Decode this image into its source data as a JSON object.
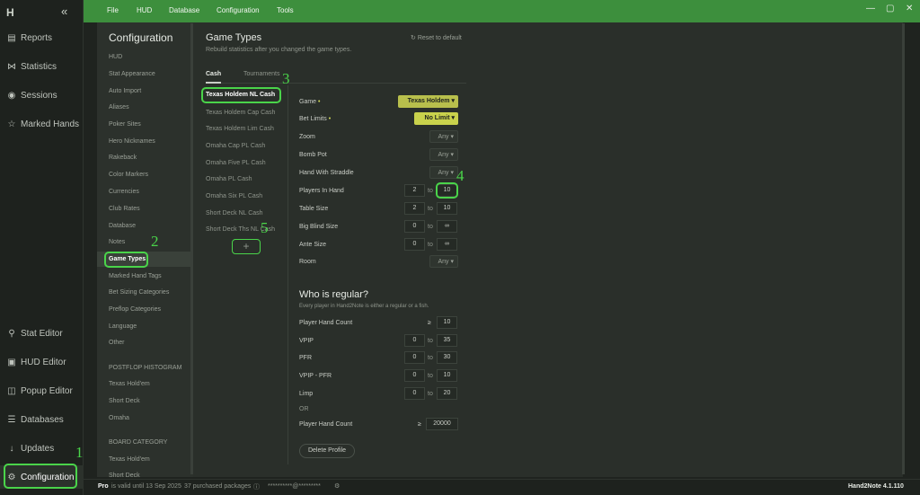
{
  "app": {
    "name": "Hand2Note",
    "version": "Hand2Note 4.1.110"
  },
  "nav": {
    "collapse": "«",
    "top_items": [
      {
        "label": "Reports",
        "icon": "report-icon"
      },
      {
        "label": "Statistics",
        "icon": "statistics-icon"
      },
      {
        "label": "Sessions",
        "icon": "sessions-icon"
      },
      {
        "label": "Marked Hands",
        "icon": "star-icon"
      }
    ],
    "bottom_items": [
      {
        "label": "Stat Editor",
        "icon": "stat-editor-icon"
      },
      {
        "label": "HUD Editor",
        "icon": "hud-editor-icon"
      },
      {
        "label": "Popup Editor",
        "icon": "popup-editor-icon"
      },
      {
        "label": "Databases",
        "icon": "database-icon"
      },
      {
        "label": "Updates",
        "icon": "updates-icon"
      },
      {
        "label": "Configuration",
        "icon": "gear-icon"
      }
    ]
  },
  "menu": [
    "File",
    "HUD",
    "Database",
    "Configuration",
    "Tools"
  ],
  "config": {
    "title": "Configuration",
    "items": [
      "HUD",
      "Stat Appearance",
      "Auto Import",
      "Aliases",
      "Poker Sites",
      "Hero Nicknames",
      "Rakeback",
      "Color Markers",
      "Currencies",
      "Club Rates",
      "Database",
      "Notes",
      "Game Types",
      "Marked Hand Tags",
      "Bet Sizing Categories",
      "Preflop Categories",
      "Language",
      "Other"
    ],
    "postflop_header": "POSTFLOP HISTOGRAM",
    "postflop_items": [
      "Texas Hold'em",
      "Short Deck",
      "Omaha"
    ],
    "board_header": "BOARD CATEGORY",
    "board_items": [
      "Texas Hold'em",
      "Short Deck"
    ]
  },
  "game_types": {
    "title": "Game Types",
    "subtitle": "Rebuild statistics after you changed the game types.",
    "reset": "Reset to default",
    "tabs": [
      "Cash",
      "Tournaments"
    ],
    "list": [
      "Texas Holdem NL Cash",
      "Texas Holdem Cap Cash",
      "Texas Holdem Lim Cash",
      "Omaha Cap PL Cash",
      "Omaha Five PL Cash",
      "Omaha PL Cash",
      "Omaha Six PL Cash",
      "Short Deck NL Cash",
      "Short Deck Ths NL Cash"
    ],
    "add": "+"
  },
  "form": {
    "game": {
      "label": "Game",
      "value": "Texas Holdem"
    },
    "bet_limits": {
      "label": "Bet Limits",
      "value": "No Limit"
    },
    "zoom": {
      "label": "Zoom",
      "value": "Any"
    },
    "bomb_pot": {
      "label": "Bomb Pot",
      "value": "Any"
    },
    "straddle": {
      "label": "Hand With Straddle",
      "value": "Any"
    },
    "players": {
      "label": "Players In Hand",
      "from": "2",
      "to": "10"
    },
    "table_size": {
      "label": "Table Size",
      "from": "2",
      "to": "10"
    },
    "big_blind": {
      "label": "Big Blind Size",
      "from": "0",
      "to": "∞"
    },
    "ante": {
      "label": "Ante Size",
      "from": "0",
      "to": "∞"
    },
    "room": {
      "label": "Room",
      "value": "Any"
    },
    "to_word": "to"
  },
  "regular": {
    "title": "Who is regular?",
    "subtitle": "Every player in Hand2Note is either a regular or a fish.",
    "hand_count": {
      "label": "Player Hand Count",
      "sign": "≥",
      "value": "10"
    },
    "vpip": {
      "label": "VPIP",
      "from": "0",
      "to": "35"
    },
    "pfr": {
      "label": "PFR",
      "from": "0",
      "to": "30"
    },
    "vpip_pfr": {
      "label": "VPIP - PFR",
      "from": "0",
      "to": "10"
    },
    "limp": {
      "label": "Limp",
      "from": "0",
      "to": "20"
    },
    "or": "OR",
    "hand_count2": {
      "label": "Player Hand Count",
      "sign": "≥",
      "value": "20000"
    },
    "delete": "Delete Profile"
  },
  "status": {
    "pro": "Pro",
    "valid": "is valid until 13 Sep 2025",
    "packages": "37 purchased packages",
    "email": "**********@*********"
  },
  "annotations": [
    "1",
    "2",
    "3",
    "4",
    "5"
  ]
}
